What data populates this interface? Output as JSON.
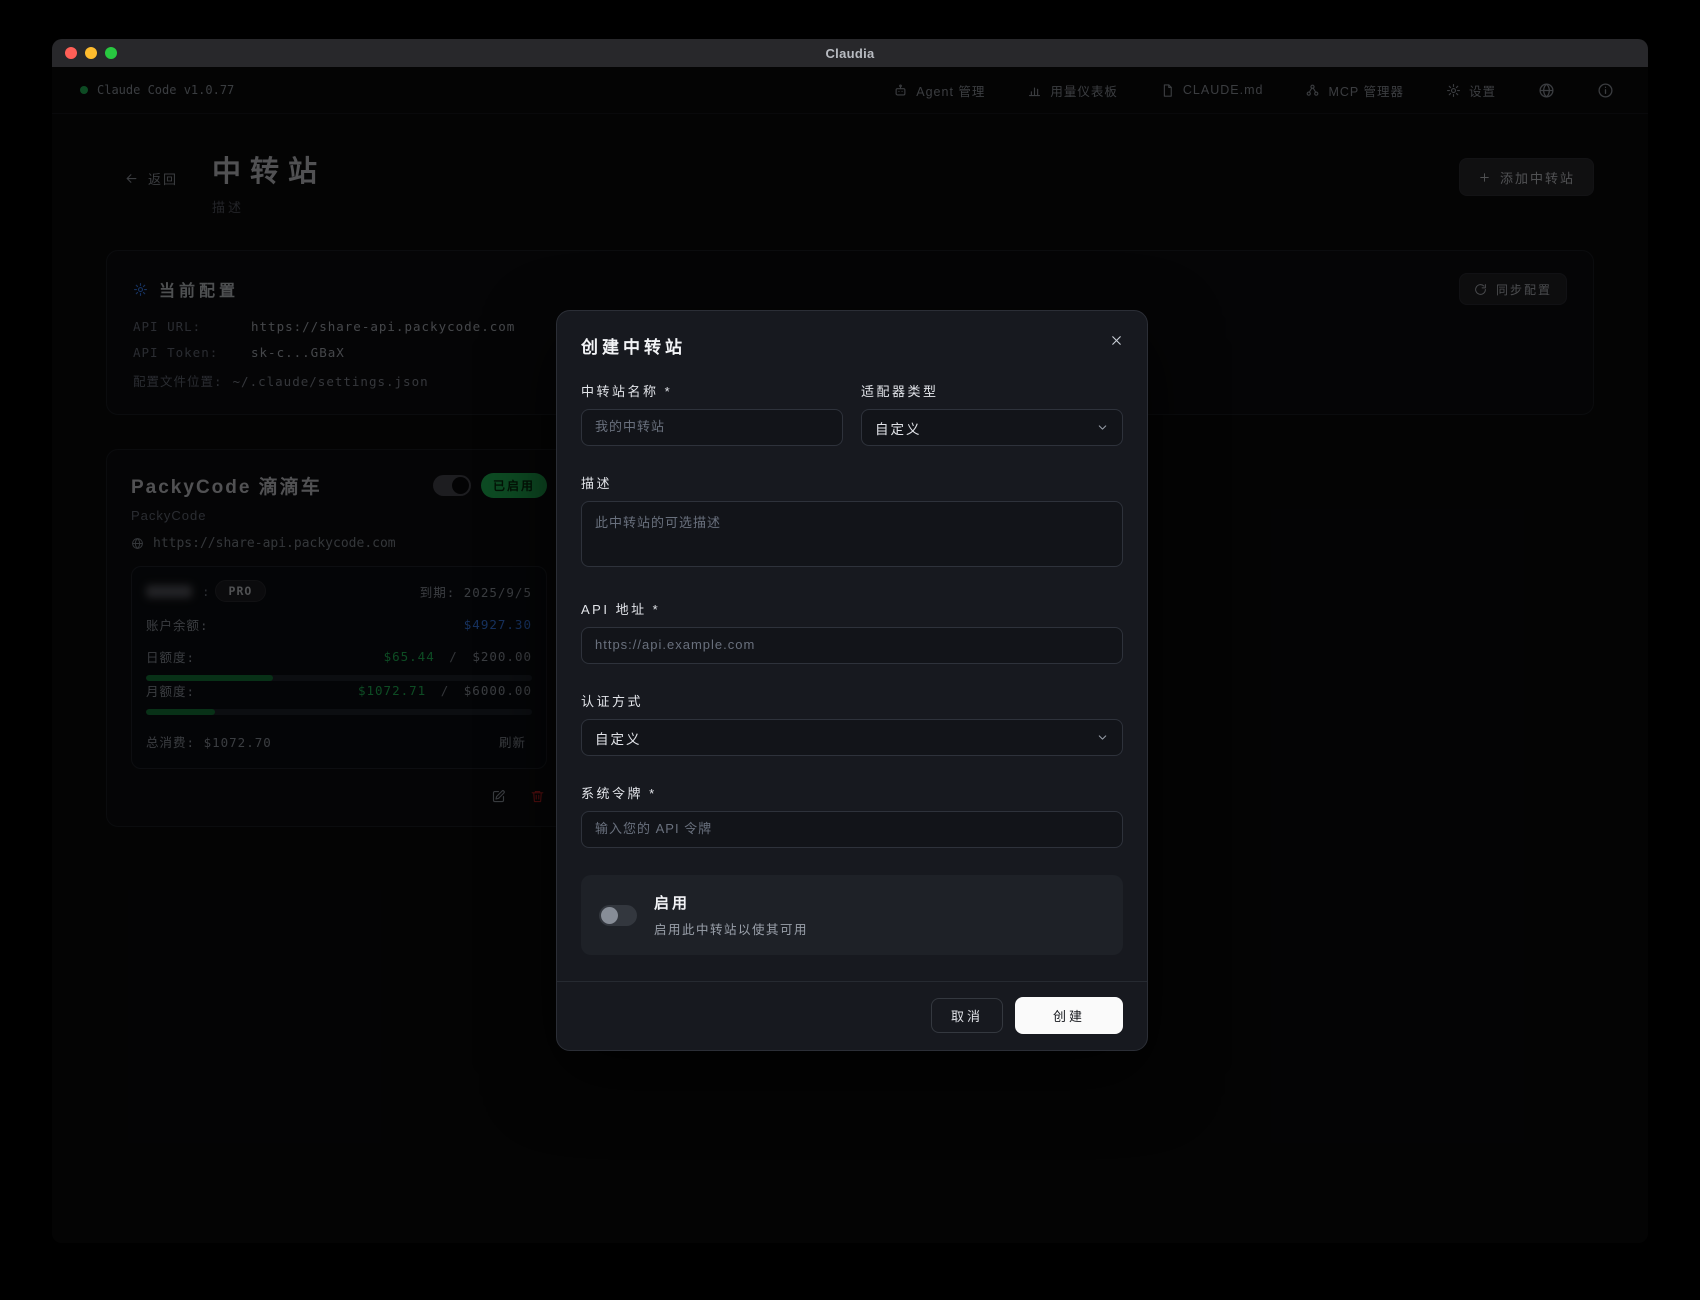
{
  "titlebar": {
    "title": "Claudia"
  },
  "navbar": {
    "brand": "Claude Code v1.0.77",
    "items": [
      {
        "label": "Agent 管理"
      },
      {
        "label": "用量仪表板"
      },
      {
        "label": "CLAUDE.md"
      },
      {
        "label": "MCP 管理器"
      },
      {
        "label": "设置"
      }
    ]
  },
  "page": {
    "back": "返回",
    "title": "中转站",
    "subtitle": "描述",
    "add_button": "添加中转站"
  },
  "config": {
    "title": "当前配置",
    "sync_button": "同步配置",
    "rows": [
      {
        "label": "API URL:",
        "value": "https://share-api.packycode.com"
      },
      {
        "label": "API Token:",
        "value": "sk-c...GBaX"
      },
      {
        "label": "配置文件位置:",
        "value": "~/.claude/settings.json"
      }
    ]
  },
  "station": {
    "name": "PackyCode 滴滴车",
    "enabled_badge": "已启用",
    "provider": "PackyCode",
    "url": "https://share-api.packycode.com",
    "plan": {
      "badge": "PRO",
      "sep": ":",
      "expiry_label": "到期:",
      "expiry_value": "2025/9/5"
    },
    "balance": {
      "label": "账户余额:",
      "value": "$4927.30"
    },
    "daily": {
      "label": "日额度:",
      "used": "$65.44",
      "sep": "/",
      "total": "$200.00",
      "percent": 33
    },
    "monthly": {
      "label": "月额度:",
      "used": "$1072.71",
      "sep": "/",
      "total": "$6000.00",
      "percent": 18
    },
    "total": {
      "label": "总消费:",
      "value": "$1072.70"
    },
    "refresh": "刷新"
  },
  "modal": {
    "title": "创建中转站",
    "name_field": {
      "label": "中转站名称 *",
      "placeholder": "我的中转站"
    },
    "adapter_field": {
      "label": "适配器类型",
      "value": "自定义"
    },
    "desc_field": {
      "label": "描述",
      "placeholder": "此中转站的可选描述"
    },
    "api_field": {
      "label": "API 地址 *",
      "placeholder": "https://api.example.com"
    },
    "auth_field": {
      "label": "认证方式",
      "value": "自定义"
    },
    "token_field": {
      "label": "系统令牌 *",
      "placeholder": "输入您的 API 令牌"
    },
    "enable": {
      "title": "启用",
      "desc": "启用此中转站以使其可用"
    },
    "cancel_button": "取消",
    "create_button": "创建"
  },
  "colors": {
    "accent_green": "#22c55e",
    "balance_blue": "#3b82f6",
    "danger_red": "#dc2626",
    "create_button_bg": "#fafafa"
  }
}
